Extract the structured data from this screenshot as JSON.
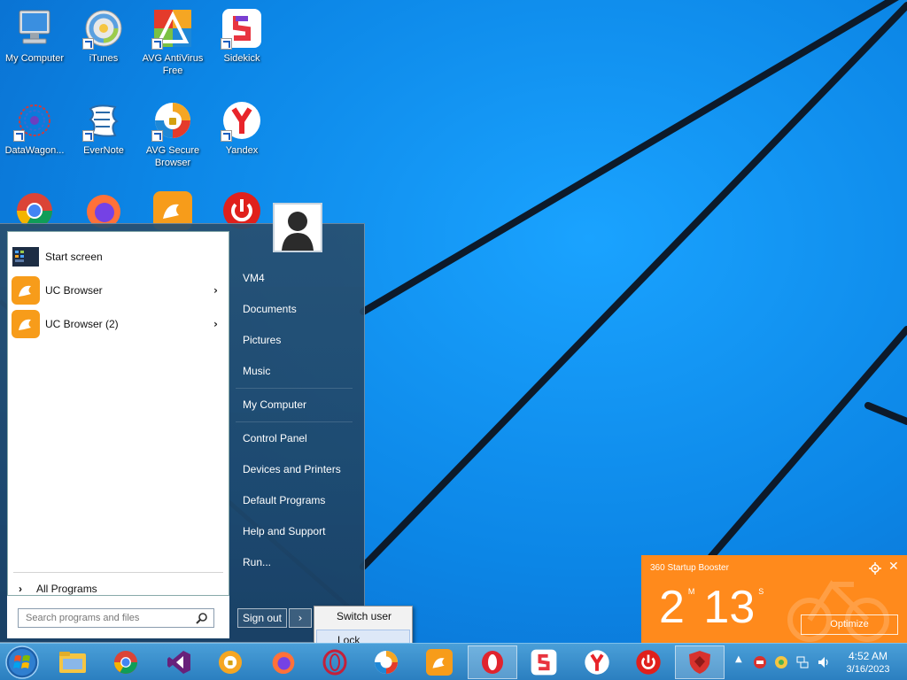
{
  "desktop": {
    "icons": [
      {
        "label": "My Computer"
      },
      {
        "label": "iTunes"
      },
      {
        "label": "AVG AntiVirus Free"
      },
      {
        "label": "Sidekick"
      },
      {
        "label": "DataWagon..."
      },
      {
        "label": "EverNote"
      },
      {
        "label": "AVG Secure Browser"
      },
      {
        "label": "Yandex"
      }
    ]
  },
  "start_menu": {
    "programs": [
      {
        "label": "Start screen",
        "icon": "start-screen-icon"
      },
      {
        "label": "UC Browser",
        "icon": "uc-browser-icon",
        "has_submenu": true
      },
      {
        "label": "UC Browser (2)",
        "icon": "uc-browser-icon",
        "has_submenu": true
      }
    ],
    "all_programs": "All Programs",
    "search_placeholder": "Search programs and files",
    "right_items": [
      "VM4",
      "Documents",
      "Pictures",
      "Music",
      "My Computer",
      "Control Panel",
      "Devices and Printers",
      "Default Programs",
      "Help and Support",
      "Run..."
    ],
    "sign_out": "Sign out",
    "power_menu": {
      "switch_user": "Switch user",
      "lock": "Lock"
    }
  },
  "booster": {
    "title": "360 Startup Booster",
    "minutes": "2",
    "minutes_unit": "M",
    "seconds": "13",
    "seconds_unit": "S",
    "optimize": "Optimize",
    "accent": "#ff8a1c"
  },
  "taskbar": {
    "pinned": [
      "file-explorer-icon",
      "chrome-icon",
      "visual-studio-icon",
      "avg-browser-icon",
      "firefox-icon",
      "opera-icon",
      "avg-secure-browser-icon",
      "uc-browser-icon",
      "opera-icon",
      "sidekick-icon",
      "yandex-icon",
      "power-app-icon",
      "shield-icon"
    ],
    "clock": {
      "time": "4:52 AM",
      "date": "3/16/2023"
    }
  }
}
